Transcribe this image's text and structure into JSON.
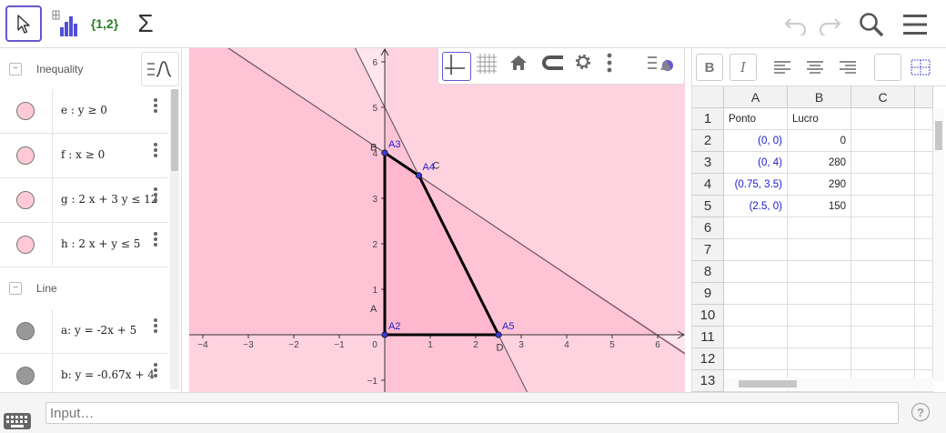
{
  "toolbar": {
    "list_tool_label": "{1,2}",
    "cas_tool_label": "Σ"
  },
  "algebra": {
    "groups": [
      {
        "label": "Inequality",
        "toggle": "−"
      },
      {
        "label": "Line",
        "toggle": "−"
      }
    ],
    "items": [
      {
        "text": "e :  y ≥ 0",
        "color": "#ffb6c8"
      },
      {
        "text": "f :  x ≥ 0",
        "color": "#ffb6c8"
      },
      {
        "text": "g :  2 x + 3 y ≤ 12",
        "color": "#ffb6c8"
      },
      {
        "text": "h :  2 x + y ≤ 5",
        "color": "#ffb6c8"
      },
      {
        "text": "a: y = -2x + 5",
        "color": "#999999"
      },
      {
        "text": "b: y = -0.67x + 4",
        "color": "#999999"
      }
    ]
  },
  "graphics": {
    "x_ticks": [
      "−4",
      "−3",
      "−2",
      "−1",
      "0",
      "1",
      "2",
      "3",
      "4",
      "5",
      "6"
    ],
    "y_ticks": [
      "6",
      "5",
      "4",
      "3",
      "2",
      "1",
      "−1"
    ],
    "points": [
      {
        "name": "A2",
        "x": 0,
        "y": 0
      },
      {
        "name": "A3",
        "x": 0,
        "y": 4
      },
      {
        "name": "A4",
        "x": 0.75,
        "y": 3.5
      },
      {
        "name": "A5",
        "x": 2.5,
        "y": 0
      }
    ],
    "extra_labels": [
      {
        "text": "A",
        "x": -0.32,
        "y": 0.5
      },
      {
        "text": "B",
        "x": -0.32,
        "y": 4.05
      },
      {
        "text": "C",
        "x": 1.05,
        "y": 3.65
      },
      {
        "text": "D",
        "x": 2.45,
        "y": -0.35
      }
    ]
  },
  "spreadsheet": {
    "columns": [
      "A",
      "B",
      "C"
    ],
    "rows": [
      "1",
      "2",
      "3",
      "4",
      "5",
      "6",
      "7",
      "8",
      "9",
      "10",
      "11",
      "12",
      "13"
    ],
    "cells": [
      [
        "Ponto",
        "Lucro",
        ""
      ],
      [
        "(0, 0)",
        "0",
        ""
      ],
      [
        "(0, 4)",
        "280",
        ""
      ],
      [
        "(0.75, 3.5)",
        "290",
        ""
      ],
      [
        "(2.5, 0)",
        "150",
        ""
      ]
    ]
  },
  "input": {
    "placeholder": "Input…",
    "help": "?"
  }
}
